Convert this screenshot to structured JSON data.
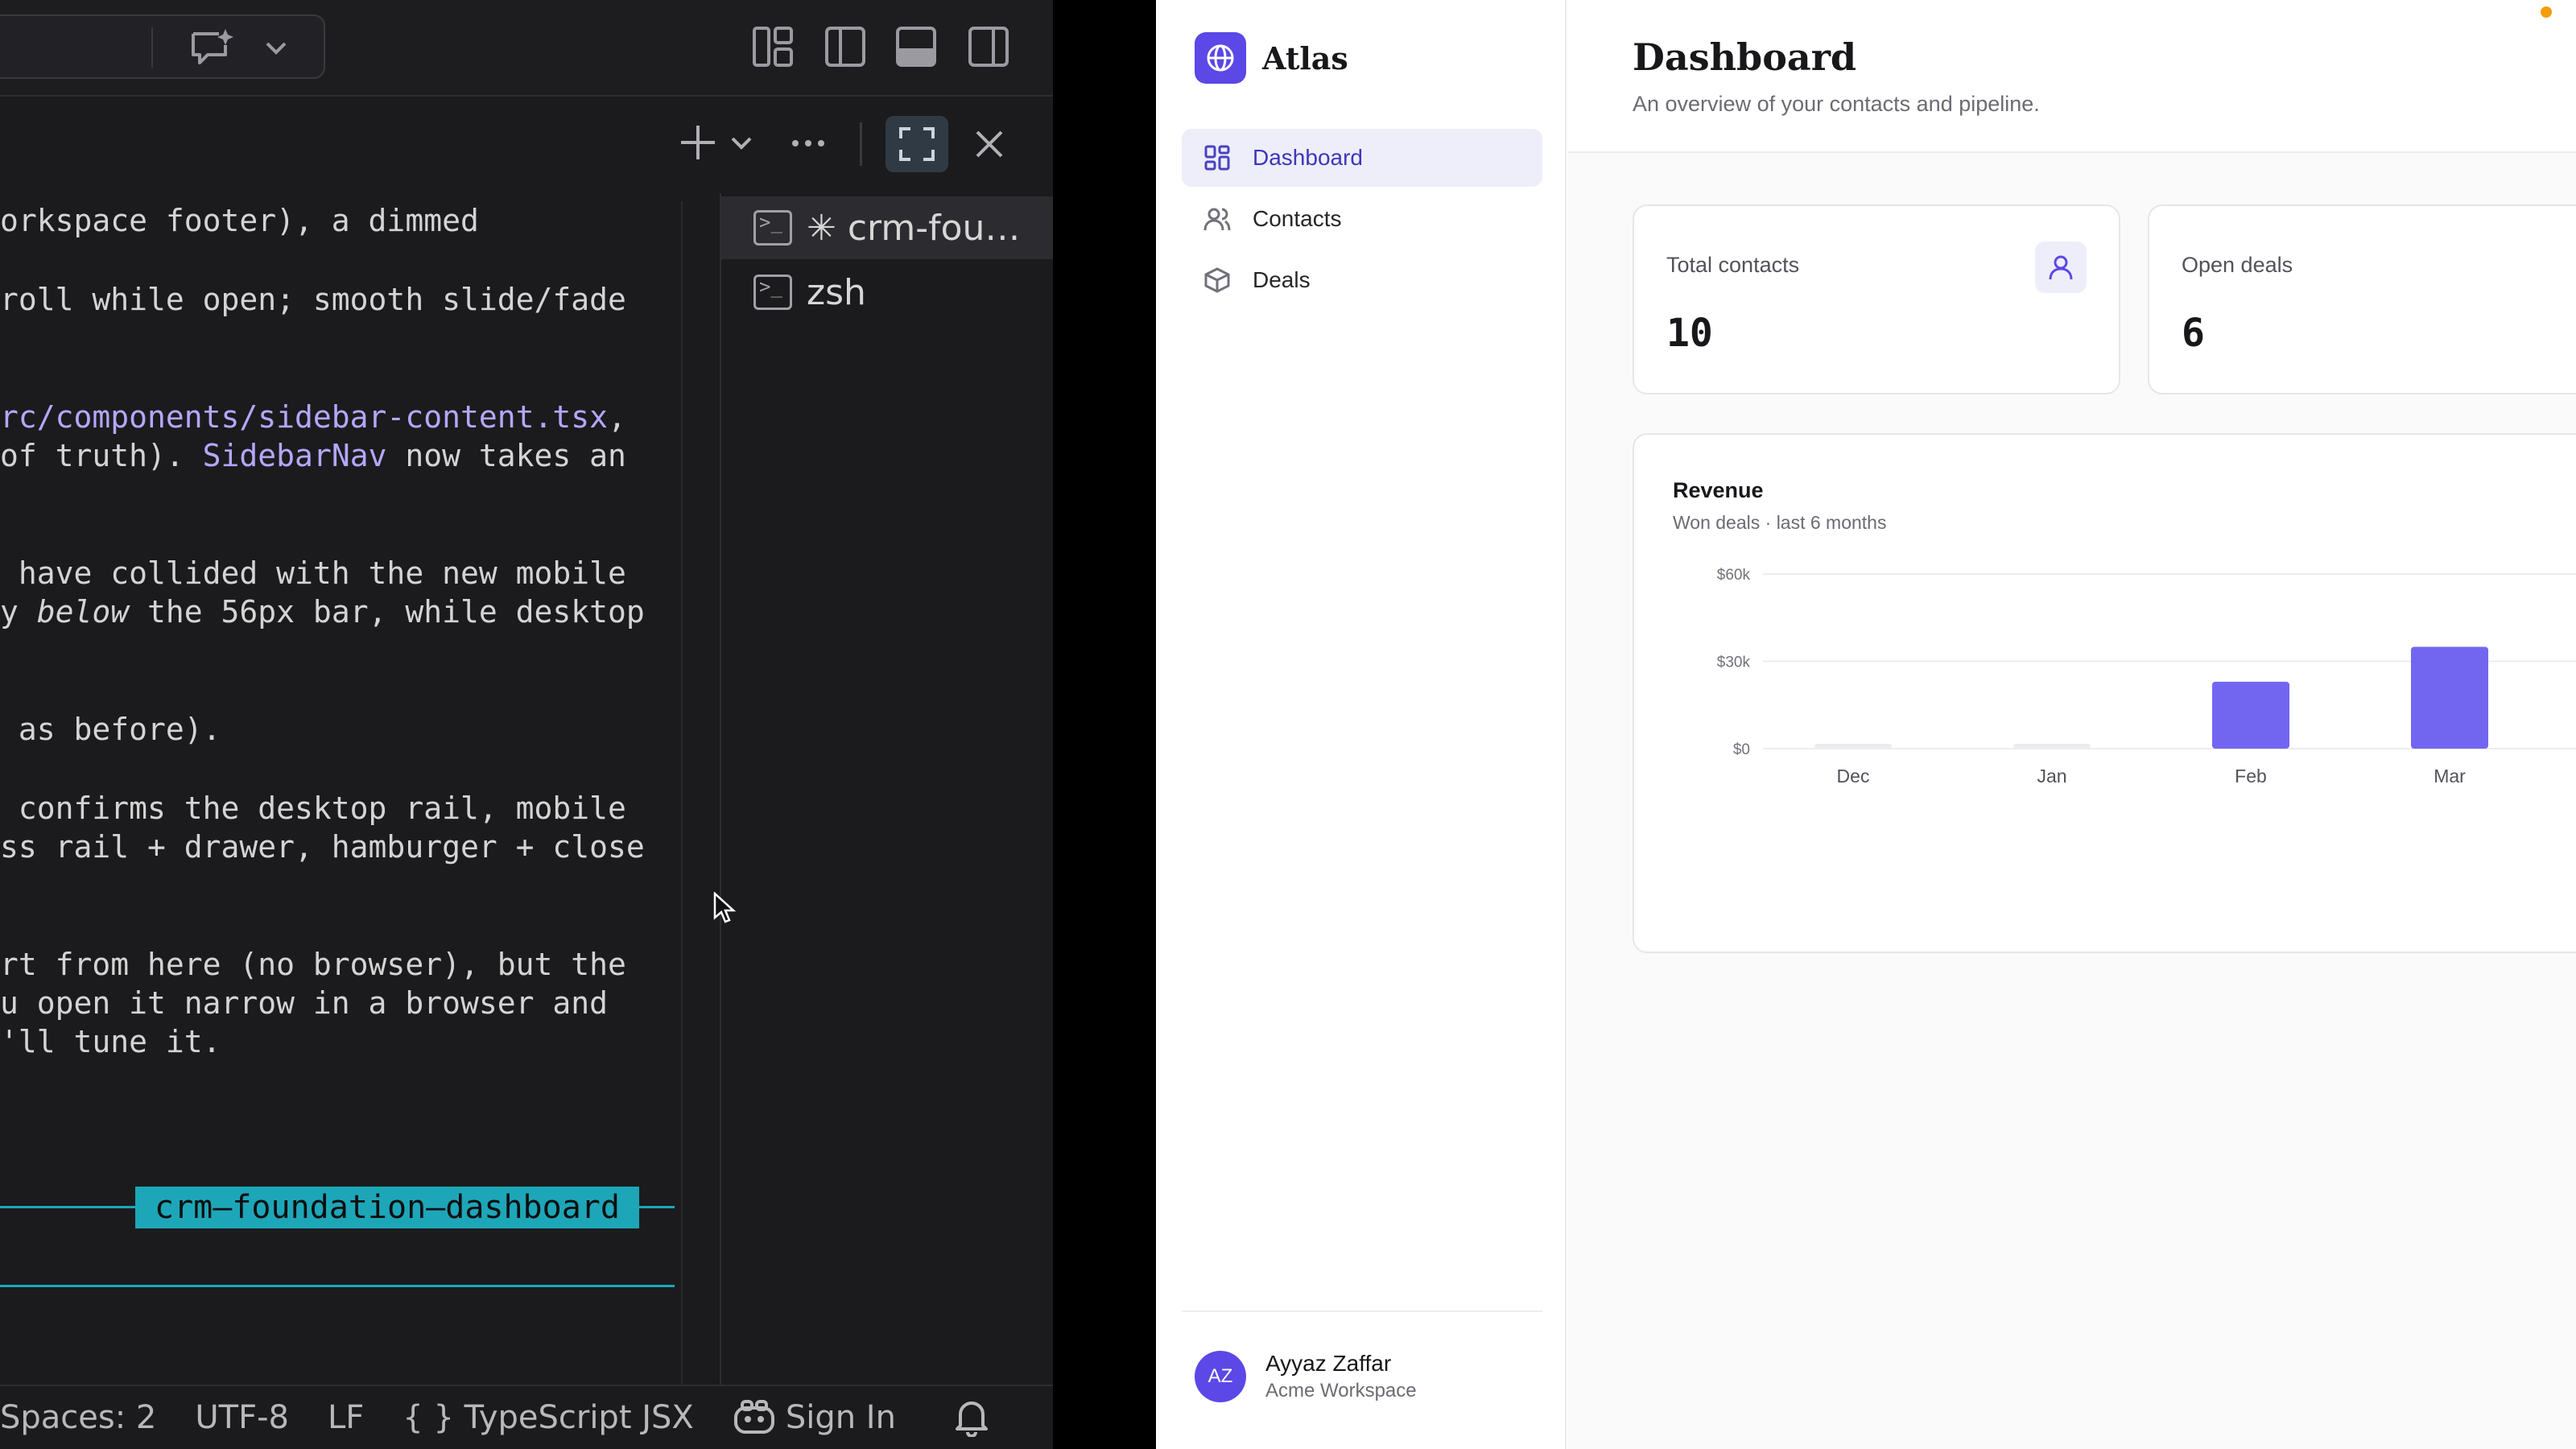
{
  "editor": {
    "lines": [
      {
        "text": "orkspace footer), a dimmed"
      },
      {
        "text": "roll while open; smooth slide/fade"
      },
      {
        "link1": "rc/components/sidebar-content.tsx",
        "rest1": ","
      },
      {
        "pre": "of truth). ",
        "link": "SidebarNav",
        "post": " now takes an"
      },
      {
        "text": " have collided with the new mobile"
      },
      {
        "pre": "y ",
        "em": "below",
        "post": " the 56px bar, while desktop"
      },
      {
        "text": " as before)."
      },
      {
        "text": " confirms the desktop rail, mobile"
      },
      {
        "text": "ss rail + drawer, hamburger + close"
      },
      {
        "text": "rt from here (no browser), but the"
      },
      {
        "text": "u open it narrow in a browser and"
      },
      {
        "text": "'ll tune it."
      }
    ],
    "terminals": [
      {
        "label": "✳ crm-fou…"
      },
      {
        "label": "zsh"
      }
    ],
    "branch_tag": "crm–foundation–dashboard",
    "status": {
      "spaces": "Spaces: 2",
      "encoding": "UTF-8",
      "eol": "LF",
      "language": "{ }  TypeScript JSX",
      "sign_in": "Sign In"
    }
  },
  "app": {
    "brand": "Atlas",
    "nav": [
      {
        "label": "Dashboard",
        "icon": "grid-icon",
        "active": true
      },
      {
        "label": "Contacts",
        "icon": "users-icon",
        "active": false
      },
      {
        "label": "Deals",
        "icon": "box-icon",
        "active": false
      }
    ],
    "user": {
      "initials": "AZ",
      "name": "Ayyaz Zaffar",
      "org": "Acme Workspace"
    },
    "page": {
      "title": "Dashboard",
      "subtitle": "An overview of your contacts and pipeline."
    },
    "stats": [
      {
        "label": "Total contacts",
        "value": "10",
        "icon": "user-icon"
      },
      {
        "label": "Open deals",
        "value": "6",
        "icon": "briefcase-icon"
      }
    ],
    "revenue": {
      "title": "Revenue",
      "subtitle": "Won deals · last 6 months"
    },
    "colors": {
      "accent": "#5b48e6",
      "bar": "#7266f0",
      "terminal_branch": "#1da6b8"
    }
  },
  "chart_data": {
    "type": "bar",
    "title": "Revenue",
    "subtitle": "Won deals · last 6 months",
    "categories": [
      "Dec",
      "Jan",
      "Feb",
      "Mar"
    ],
    "values": [
      0,
      0,
      23000,
      35000
    ],
    "y_ticks": [
      "$0",
      "$30k",
      "$60k"
    ],
    "ylim": [
      0,
      65000
    ],
    "grid": true
  }
}
